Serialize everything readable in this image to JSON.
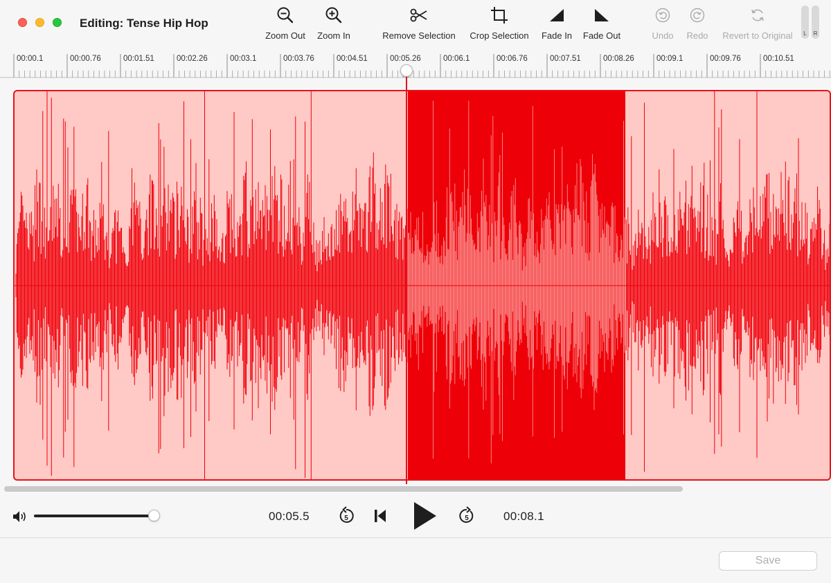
{
  "window": {
    "title": "Editing: Tense Hip Hop"
  },
  "toolbar": {
    "zoom_out": "Zoom Out",
    "zoom_in": "Zoom In",
    "remove_selection": "Remove Selection",
    "crop_selection": "Crop Selection",
    "fade_in": "Fade In",
    "fade_out": "Fade Out",
    "undo": "Undo",
    "redo": "Redo",
    "revert": "Revert to Original"
  },
  "meters": {
    "left": "L",
    "right": "R"
  },
  "ruler": {
    "ticks": [
      "00:00.1",
      "00:00.76",
      "00:01.51",
      "00:02.26",
      "00:03.1",
      "00:03.76",
      "00:04.51",
      "00:05.26",
      "00:06.1",
      "00:06.76",
      "00:07.51",
      "00:08.26",
      "00:09.1",
      "00:09.76",
      "00:10.51"
    ]
  },
  "transport": {
    "current_time": "00:05.5",
    "end_time": "00:08.1",
    "skip_back_seconds": "5",
    "skip_forward_seconds": "5",
    "volume_level": 1.0
  },
  "footer": {
    "save_label": "Save"
  },
  "colors": {
    "waveform": "#f0000a",
    "unselected_bg": "#ffc9c5",
    "selection_bg": "#ee0008",
    "selection_wave": "#ffb0ac",
    "playhead": "#e4101b"
  },
  "icons": {
    "zoom_out": "magnifier-minus-icon",
    "zoom_in": "magnifier-plus-icon",
    "remove_selection": "scissors-icon",
    "crop_selection": "crop-icon",
    "fade_in": "fade-in-icon",
    "fade_out": "fade-out-icon",
    "undo": "undo-icon",
    "redo": "redo-icon",
    "revert": "revert-icon",
    "volume": "speaker-icon",
    "skip_back": "skip-back-5-icon",
    "to_start": "skip-to-start-icon",
    "play": "play-icon",
    "skip_forward": "skip-forward-5-icon"
  }
}
